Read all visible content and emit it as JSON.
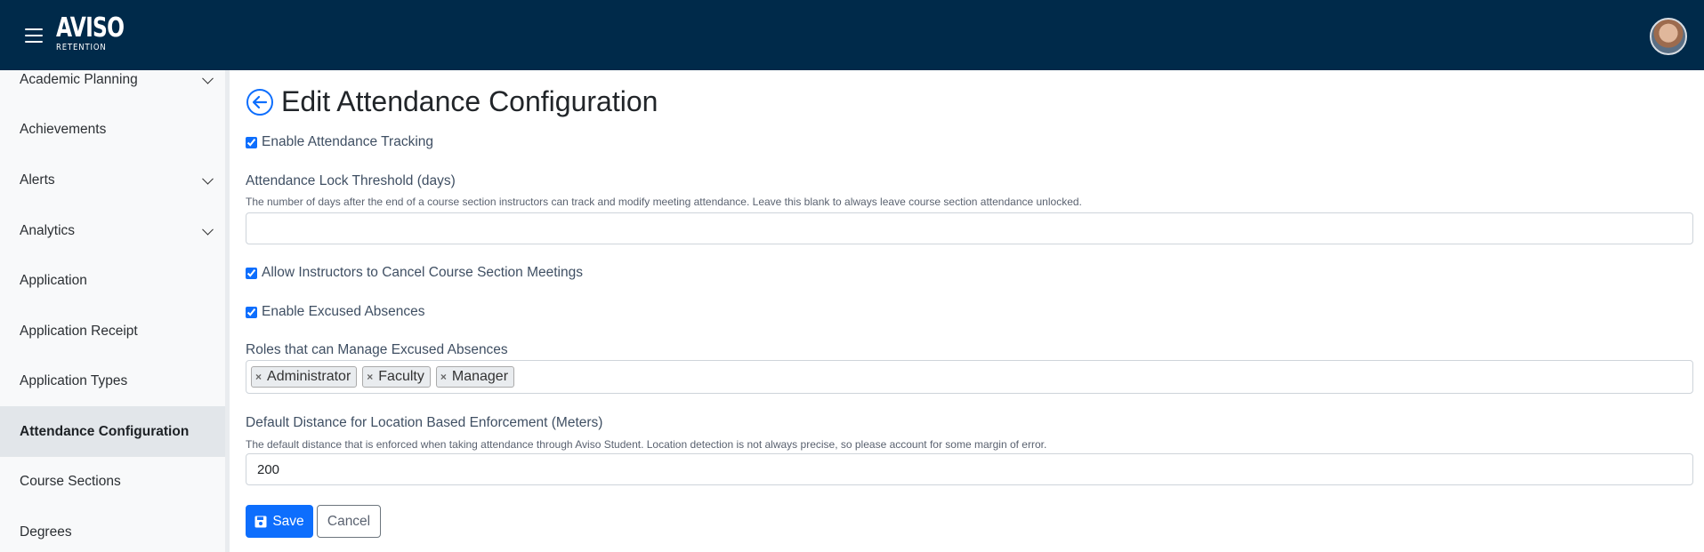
{
  "header": {
    "logo_main": "AVISO",
    "logo_sub": "RETENTION"
  },
  "sidebar": {
    "items": [
      {
        "label": "Academic Planning",
        "expandable": true
      },
      {
        "label": "Achievements",
        "expandable": false
      },
      {
        "label": "Alerts",
        "expandable": true
      },
      {
        "label": "Analytics",
        "expandable": true
      },
      {
        "label": "Application",
        "expandable": false
      },
      {
        "label": "Application Receipt",
        "expandable": false
      },
      {
        "label": "Application Types",
        "expandable": false
      },
      {
        "label": "Attendance Configuration",
        "expandable": false,
        "active": true
      },
      {
        "label": "Course Sections",
        "expandable": false
      },
      {
        "label": "Degrees",
        "expandable": false
      }
    ]
  },
  "main": {
    "title": "Edit Attendance Configuration",
    "enable_tracking": {
      "label": "Enable Attendance Tracking",
      "checked": true
    },
    "lock_threshold": {
      "label": "Attendance Lock Threshold (days)",
      "help": "The number of days after the end of a course section instructors can track and modify meeting attendance. Leave this blank to always leave course section attendance unlocked.",
      "value": ""
    },
    "allow_cancel": {
      "label": "Allow Instructors to Cancel Course Section Meetings",
      "checked": true
    },
    "excused_absences": {
      "label": "Enable Excused Absences",
      "checked": true
    },
    "roles": {
      "label": "Roles that can Manage Excused Absences",
      "tags": [
        "Administrator",
        "Faculty",
        "Manager"
      ]
    },
    "distance": {
      "label": "Default Distance for Location Based Enforcement (Meters)",
      "help": "The default distance that is enforced when taking attendance through Aviso Student. Location detection is not always precise, so please account for some margin of error.",
      "value": "200"
    },
    "save_label": "Save",
    "cancel_label": "Cancel"
  },
  "colors": {
    "topbar": "#002a4a",
    "primary": "#0d6efd",
    "sidebar_bg": "#f8f9fa",
    "sidebar_active": "#e2e6ea"
  }
}
